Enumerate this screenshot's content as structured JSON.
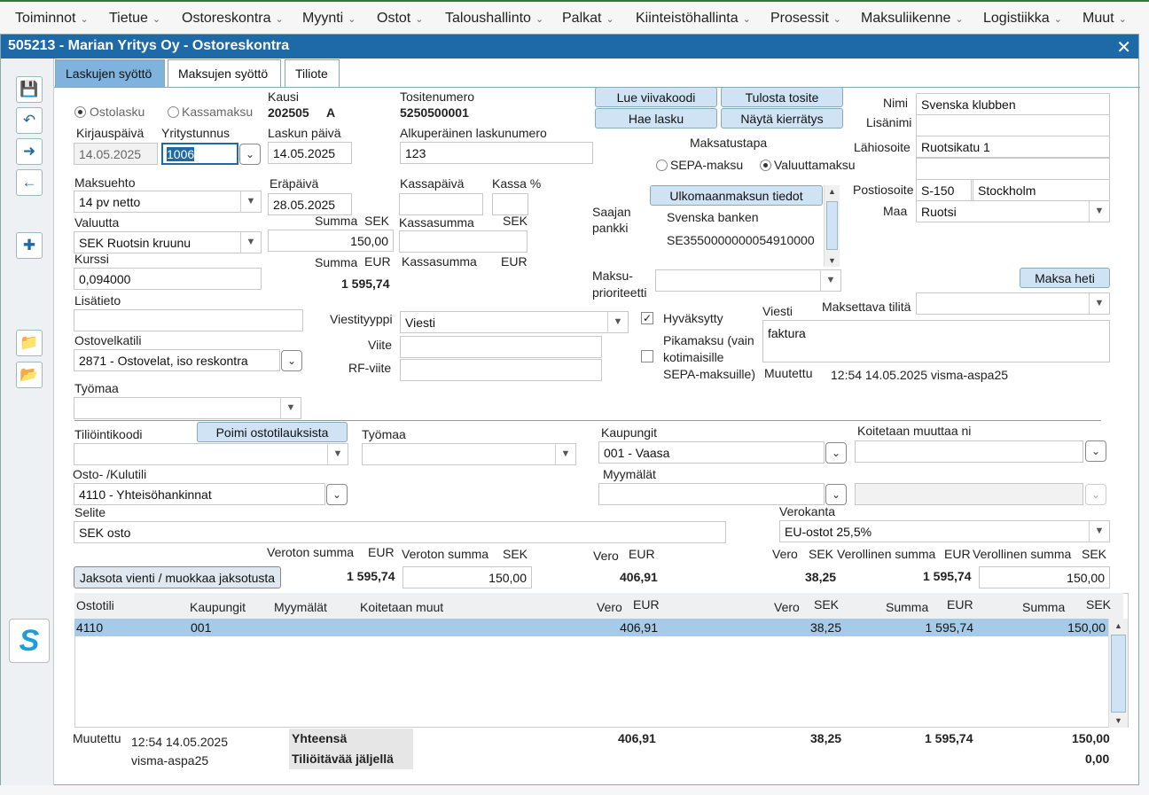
{
  "menu": [
    "Toiminnot",
    "Tietue",
    "Ostoreskontra",
    "Myynti",
    "Ostot",
    "Taloushallinto",
    "Palkat",
    "Kiinteistöhallinta",
    "Prosessit",
    "Maksuliikenne",
    "Logistiikka",
    "Muut"
  ],
  "window_title": "505213 - Marian Yritys Oy - Ostoreskontra",
  "tabs": [
    "Laskujen syöttö",
    "Maksujen syöttö",
    "Tiliote"
  ],
  "left": {
    "radio_ostolasku": "Ostolasku",
    "radio_kassamaksu": "Kassamaksu",
    "kausi_label": "Kausi",
    "kausi_value": "202505",
    "kausi_flag": "A",
    "tositenumero_label": "Tositenumero",
    "tositenumero_value": "5250500001",
    "kirjauspaiva_label": "Kirjauspäivä",
    "kirjauspaiva_value": "14.05.2025",
    "yritystunnus_label": "Yritystunnus",
    "yritystunnus_value": "1006",
    "laskun_paiva_label": "Laskun päivä",
    "laskun_paiva_value": "14.05.2025",
    "alkup_label": "Alkuperäinen laskunumero",
    "alkup_value": "123",
    "maksuehto_label": "Maksuehto",
    "maksuehto_value": "14 pv netto",
    "erapaiva_label": "Eräpäivä",
    "erapaiva_value": "28.05.2025",
    "kassapaiva_label": "Kassapäivä",
    "kassa_pct_label": "Kassa %",
    "valuutta_label": "Valuutta",
    "valuutta_value": "SEK Ruotsin kruunu",
    "summa_label": "Summa",
    "sek": "SEK",
    "eur": "EUR",
    "summa_sek_value": "150,00",
    "kassasumma_label": "Kassasumma",
    "kurssi_label": "Kurssi",
    "kurssi_value": "0,094000",
    "summa_eur_value": "1 595,74",
    "lisatieto_label": "Lisätieto",
    "viestityyppi_label": "Viestityyppi",
    "viestityyppi_value": "Viesti",
    "ostovelkatili_label": "Ostovelkatili",
    "ostovelkatili_value": "2871 - Ostovelat, iso reskontra",
    "viite_label": "Viite",
    "rf_viite_label": "RF-viite",
    "tyomaa_label": "Työmaa"
  },
  "middle": {
    "lue_viivakoodi": "Lue viivakoodi",
    "tulosta_tosite": "Tulosta tosite",
    "hae_lasku": "Hae lasku",
    "nayta_kierratys": "Näytä kierrätys",
    "maksatustapa_label": "Maksatustapa",
    "sepa_maksu": "SEPA-maksu",
    "valuuttamaksu": "Valuuttamaksu",
    "ulkomaan_button": "Ulkomaanmaksun tiedot",
    "saajan_pankki_1": "Saajan",
    "saajan_pankki_2": "pankki",
    "bank_name": "Svenska banken",
    "iban": "SE3550000000054910000",
    "maksuprioriteetti_1": "Maksu-",
    "maksuprioriteetti_2": "prioriteetti",
    "hyvaksytty": "Hyväksytty",
    "pikamaksu_1": "Pikamaksu (vain",
    "pikamaksu_2": "kotimaisille",
    "pikamaksu_3": "SEPA-maksuille)",
    "viesti_label": "Viesti",
    "viesti_value": "faktura",
    "muutettu_label": "Muutettu",
    "muutettu_value": "12:54 14.05.2025 visma-aspa25"
  },
  "right": {
    "nimi_label": "Nimi",
    "nimi_value": "Svenska klubben",
    "lisanimi_label": "Lisänimi",
    "lahiosoite_label": "Lähiosoite",
    "lahiosoite_value": "Ruotsikatu 1",
    "postiosoite_label": "Postiosoite",
    "postinumero": "S-150",
    "postitoimipaikka": "Stockholm",
    "maa_label": "Maa",
    "maa_value": "Ruotsi",
    "maksa_heti": "Maksa heti",
    "maksettava_tilita_label": "Maksettava tilitä"
  },
  "lower": {
    "tiliointikoodi_label": "Tiliöintikoodi",
    "poimi_button": "Poimi ostotilauksista",
    "tyomaa_label": "Työmaa",
    "kaupungit_label": "Kaupungit",
    "kaupungit_value": "001 - Vaasa",
    "koitetaan_label": "Koitetaan muuttaa ni",
    "osto_kulutili_label": "Osto- /Kulutili",
    "osto_kulutili_value": "4110 - Yhteisöhankinnat",
    "myymalat_label": "Myymälät",
    "selite_label": "Selite",
    "selite_value": "SEK osto",
    "verokanta_label": "Verokanta",
    "verokanta_value": "EU-ostot 25,5%",
    "veroton_summa_label": "Veroton summa",
    "veroton_eur_value": "1 595,74",
    "veroton_sek_value": "150,00",
    "vero_label": "Vero",
    "vero_eur_value": "406,91",
    "vero_sek_value": "38,25",
    "verollinen_summa_label": "Verollinen summa",
    "verollinen_eur_value": "1 595,74",
    "verollinen_sek_value": "150,00",
    "jaksota_button": "Jaksota vienti / muokkaa jaksotusta"
  },
  "grid": {
    "headers": {
      "ostotili": "Ostotili",
      "kaupungit": "Kaupungit",
      "myymalat": "Myymälät",
      "koitetaan": "Koitetaan muut",
      "vero": "Vero",
      "summa": "Summa",
      "eur": "EUR",
      "sek": "SEK"
    },
    "rows": [
      {
        "ostotili": "4110",
        "kaupungit": "001",
        "vero_eur": "406,91",
        "vero_sek": "38,25",
        "summa_eur": "1 595,74",
        "summa_sek": "150,00"
      }
    ]
  },
  "footer": {
    "muutettu_label": "Muutettu",
    "muutettu_time": "12:54 14.05.2025",
    "muutettu_user": "visma-aspa25",
    "yhteensa_label": "Yhteensä",
    "tilioitavaa_label": "Tiliöitävää jäljellä",
    "yht_vero_eur": "406,91",
    "yht_vero_sek": "38,25",
    "yht_summa_eur": "1 595,74",
    "yht_summa_sek": "150,00",
    "jaljella": "0,00"
  }
}
